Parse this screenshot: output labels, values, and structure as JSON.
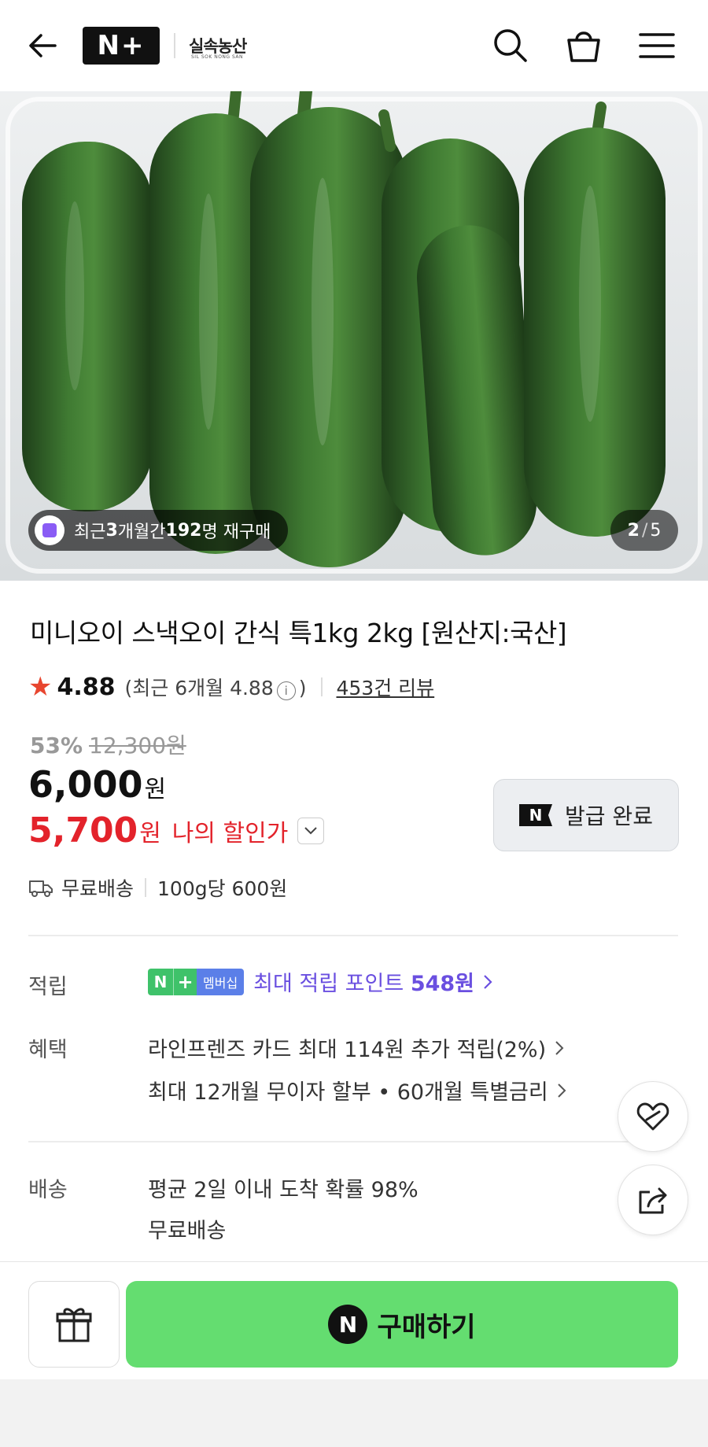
{
  "header": {
    "logo_text": "N+",
    "brand_name": "실속농산",
    "brand_sub": "SIL SOK NONG SAN"
  },
  "hero": {
    "image_subject": "cucumbers in a clear plastic tray",
    "repurchase_badge": {
      "prefix": "최근 ",
      "months": "3",
      "mid": "개월간 ",
      "count": "192",
      "suffix": "명 재구매"
    },
    "page_current": "2",
    "page_separator": "/",
    "page_total": "5"
  },
  "product": {
    "title": "미니오이 스낵오이 간식 특1kg 2kg [원산지:국산]",
    "rating": "4.88",
    "rating_note_prefix": "(최근 6개월 4.88",
    "rating_note_suffix": ")",
    "review_count": "453건 리뷰",
    "discount_percent": "53%",
    "original_price": "12,300원",
    "price": "6,000",
    "price_unit": "원",
    "my_price": "5,700",
    "my_price_unit": "원",
    "my_price_label": "나의 할인가",
    "coupon_label": "발급 완료",
    "coupon_icon_text": "N",
    "shipping": "무료배송",
    "unit_price": "100g당 600원"
  },
  "benefits": {
    "reward_label": "적립",
    "membership_n": "N",
    "membership_plus": "+",
    "membership_badge": "멤버십",
    "reward_text_prefix": "최대 적립 포인트 ",
    "reward_points": "548원",
    "benefit_label": "혜택",
    "benefit_line1": "라인프렌즈 카드 최대 114원 추가 적립(2%)",
    "benefit_line2": "최대 12개월 무이자 할부 • 60개월 특별금리",
    "delivery_label": "배송",
    "delivery_line1": "평균 2일 이내 도착 확률 98%",
    "delivery_line2": "무료배송"
  },
  "bottom": {
    "buy_icon_text": "N",
    "buy_label": "구매하기"
  },
  "colors": {
    "accent_red": "#e3232b",
    "buy_green": "#64dd70",
    "reward_purple": "#6a4fe0",
    "star": "#e8462f"
  },
  "icons": [
    "back-arrow-icon",
    "search-icon",
    "shopping-bag-icon",
    "menu-icon",
    "star-icon",
    "info-icon",
    "chevron-down-icon",
    "truck-icon",
    "chevron-right-icon",
    "heart-icon",
    "share-icon",
    "gift-icon"
  ]
}
